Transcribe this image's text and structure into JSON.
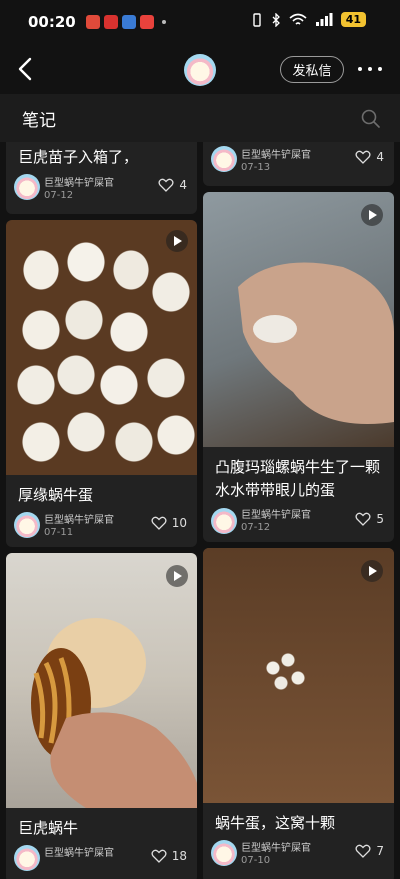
{
  "status_bar": {
    "time": "00:20",
    "battery": "41"
  },
  "header": {
    "dm_label": "发私信"
  },
  "section": {
    "title": "笔记"
  },
  "cards": [
    {
      "title": "巨虎苗子入箱了，",
      "author": "巨型蜗牛铲屎官",
      "date": "07-12",
      "likes": "4"
    },
    {
      "title": "",
      "author": "巨型蜗牛铲屎官",
      "date": "07-13",
      "likes": "4"
    },
    {
      "title": "厚缘蜗牛蛋",
      "author": "巨型蜗牛铲屎官",
      "date": "07-11",
      "likes": "10"
    },
    {
      "title": "凸腹玛瑙螺蜗牛生了一颗水水带带眼儿的蛋",
      "author": "巨型蜗牛铲屎官",
      "date": "07-12",
      "likes": "5"
    },
    {
      "title": "巨虎蜗牛",
      "author": "巨型蜗牛铲屎官",
      "date": "",
      "likes": "18"
    },
    {
      "title": "蜗牛蛋，这窝十颗",
      "author": "巨型蜗牛铲屎官",
      "date": "07-10",
      "likes": "7"
    }
  ],
  "icons": {
    "back": "back-arrow-icon",
    "more": "more-dots-icon",
    "search": "search-icon",
    "like": "heart-icon",
    "play": "play-icon"
  },
  "colors": {
    "background": "#121212",
    "card": "#222222",
    "battery": "#f2c230"
  }
}
